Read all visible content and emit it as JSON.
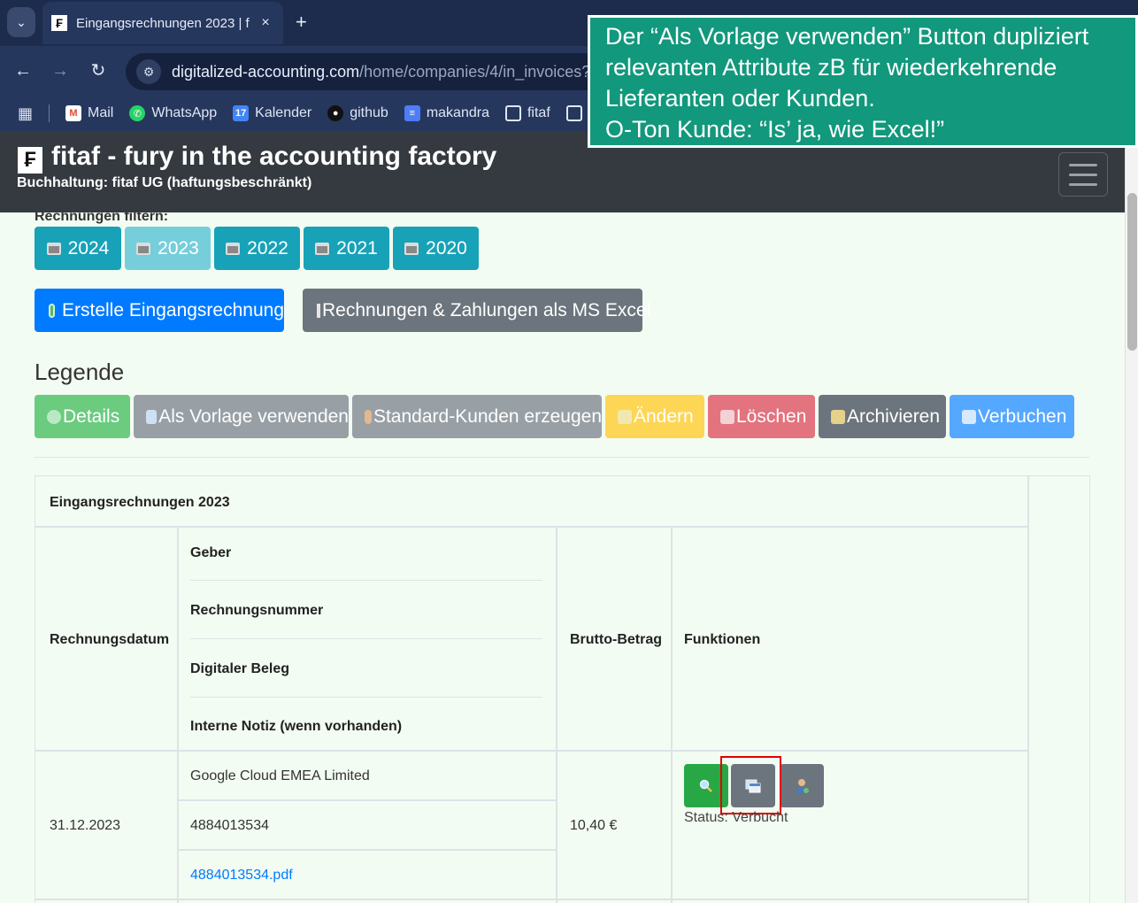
{
  "browser": {
    "tab_title": "Eingangsrechnungen 2023 | f",
    "tab_favicon": "₣",
    "new_tab": "+",
    "close": "×",
    "url_host": "digitalized-accounting.com",
    "url_path": "/home/companies/4/in_invoices?",
    "bookmarks": [
      {
        "label": "Mail",
        "icon": "gmail-icon",
        "color": "#ea4335"
      },
      {
        "label": "WhatsApp",
        "icon": "whatsapp-icon",
        "color": "#25d366"
      },
      {
        "label": "Kalender",
        "icon": "calendar-icon",
        "color": "#4285f4"
      },
      {
        "label": "github",
        "icon": "github-icon",
        "color": "#333333"
      },
      {
        "label": "makandra",
        "icon": "makandra-icon",
        "color": "#4f7cf7"
      },
      {
        "label": "fitaf",
        "icon": "folder-icon",
        "color": "#26375d"
      }
    ]
  },
  "header": {
    "logo": "₣",
    "title": "fitaf - fury in the accounting factory",
    "subtitle": "Buchhaltung: fitaf UG (haftungsbeschränkt)"
  },
  "filters": {
    "label": "Rechnungen filtern:",
    "years": [
      "2024",
      "2023",
      "2022",
      "2021",
      "2020"
    ],
    "active_year": "2023"
  },
  "actions": {
    "create": "Erstelle Eingangsrechnung",
    "export": "Rechnungen & Zahlungen als MS Excel"
  },
  "legend": {
    "title": "Legende",
    "items": [
      {
        "label": "Details",
        "color": "#6bcb7f"
      },
      {
        "label": "Als Vorlage verwenden",
        "color": "#98a0a6"
      },
      {
        "label": "Standard-Kunden erzeugen",
        "color": "#98a0a6"
      },
      {
        "label": "Ändern",
        "color": "#fed655"
      },
      {
        "label": "Löschen",
        "color": "#e3737e"
      },
      {
        "label": "Archivieren",
        "color": "#6c757d"
      },
      {
        "label": "Verbuchen",
        "color": "#55a8ff"
      }
    ]
  },
  "table": {
    "caption": "Eingangsrechnungen 2023",
    "headers": {
      "date": "Rechnungsdatum",
      "issuer": "Geber",
      "number": "Rechnungsnummer",
      "receipt": "Digitaler Beleg",
      "note": "Interne Notiz (wenn vorhanden)",
      "amount": "Brutto-Betrag",
      "functions": "Funktionen"
    },
    "rows": [
      {
        "date": "31.12.2023",
        "issuer": "Google Cloud EMEA Limited",
        "number": "4884013534",
        "receipt": "4884013534.pdf",
        "amount": "10,40 €",
        "status": "Status: Verbucht"
      }
    ]
  },
  "annotation": {
    "lines": [
      "Der “Als Vorlage verwenden” Button dupliziert",
      "relevanten Attribute zB für wiederkehrende",
      "Lieferanten oder Kunden.",
      "O-Ton Kunde: “Is’ ja, wie Excel!”"
    ],
    "color": "#12987c",
    "highlight_color": "#e00000"
  }
}
